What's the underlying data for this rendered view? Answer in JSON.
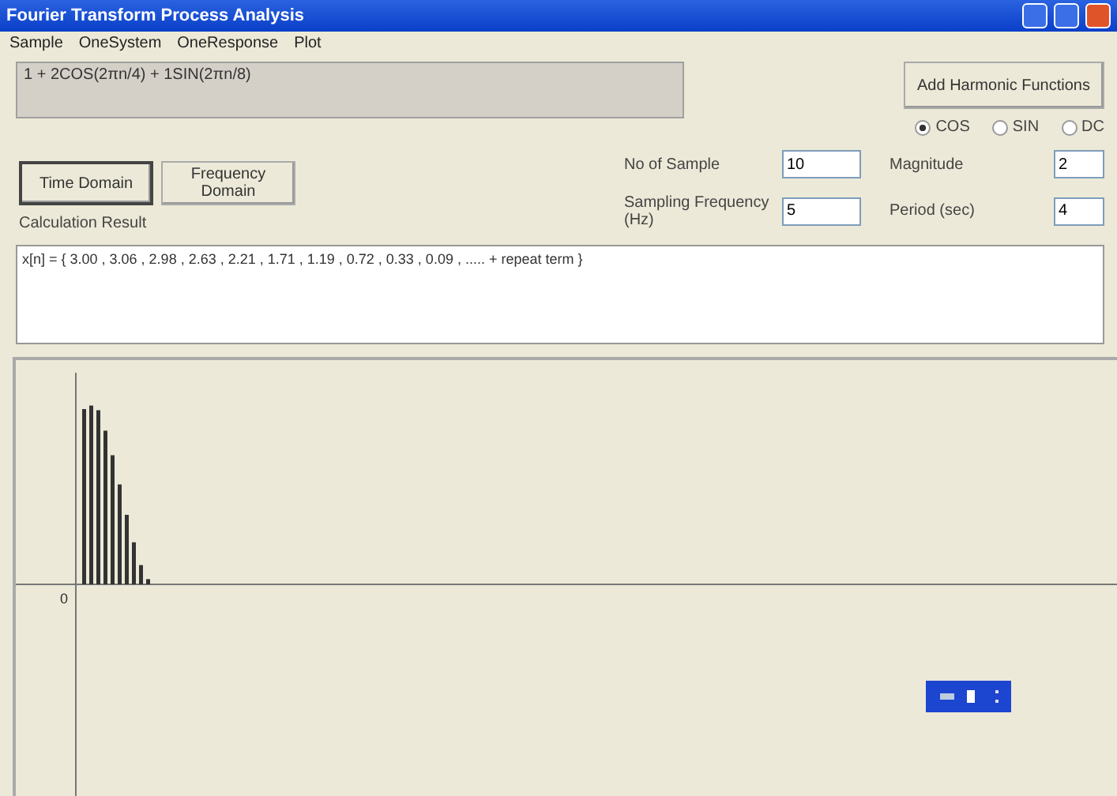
{
  "window": {
    "title": "Fourier Transform Process Analysis"
  },
  "menu": [
    "Sample",
    "OneSystem",
    "OneResponse",
    "Plot"
  ],
  "formula": "1 + 2COS(2πn/4) + 1SIN(2πn/8)",
  "add_button": "Add Harmonic Functions",
  "radios": [
    {
      "label": "COS",
      "selected": true
    },
    {
      "label": "SIN",
      "selected": false
    },
    {
      "label": "DC",
      "selected": false
    }
  ],
  "domain_tabs": [
    {
      "label": "Time Domain",
      "selected": true
    },
    {
      "label": "Frequency Domain",
      "selected": false
    }
  ],
  "result_label": "Calculation Result",
  "fields": [
    {
      "label": "No of Sample",
      "value": "10"
    },
    {
      "label": "Magnitude",
      "value": "2"
    },
    {
      "label": "Sampling Frequency (Hz)",
      "value": "5"
    },
    {
      "label": "Period (sec)",
      "value": "4"
    }
  ],
  "result": "x[n] = { 3.00 , 3.06 , 2.98 , 2.63 , 2.21 , 1.71 , 1.19 , 0.72 , 0.33 , 0.09 , ..... + repeat term }",
  "plot": {
    "zero_label": "0"
  }
}
